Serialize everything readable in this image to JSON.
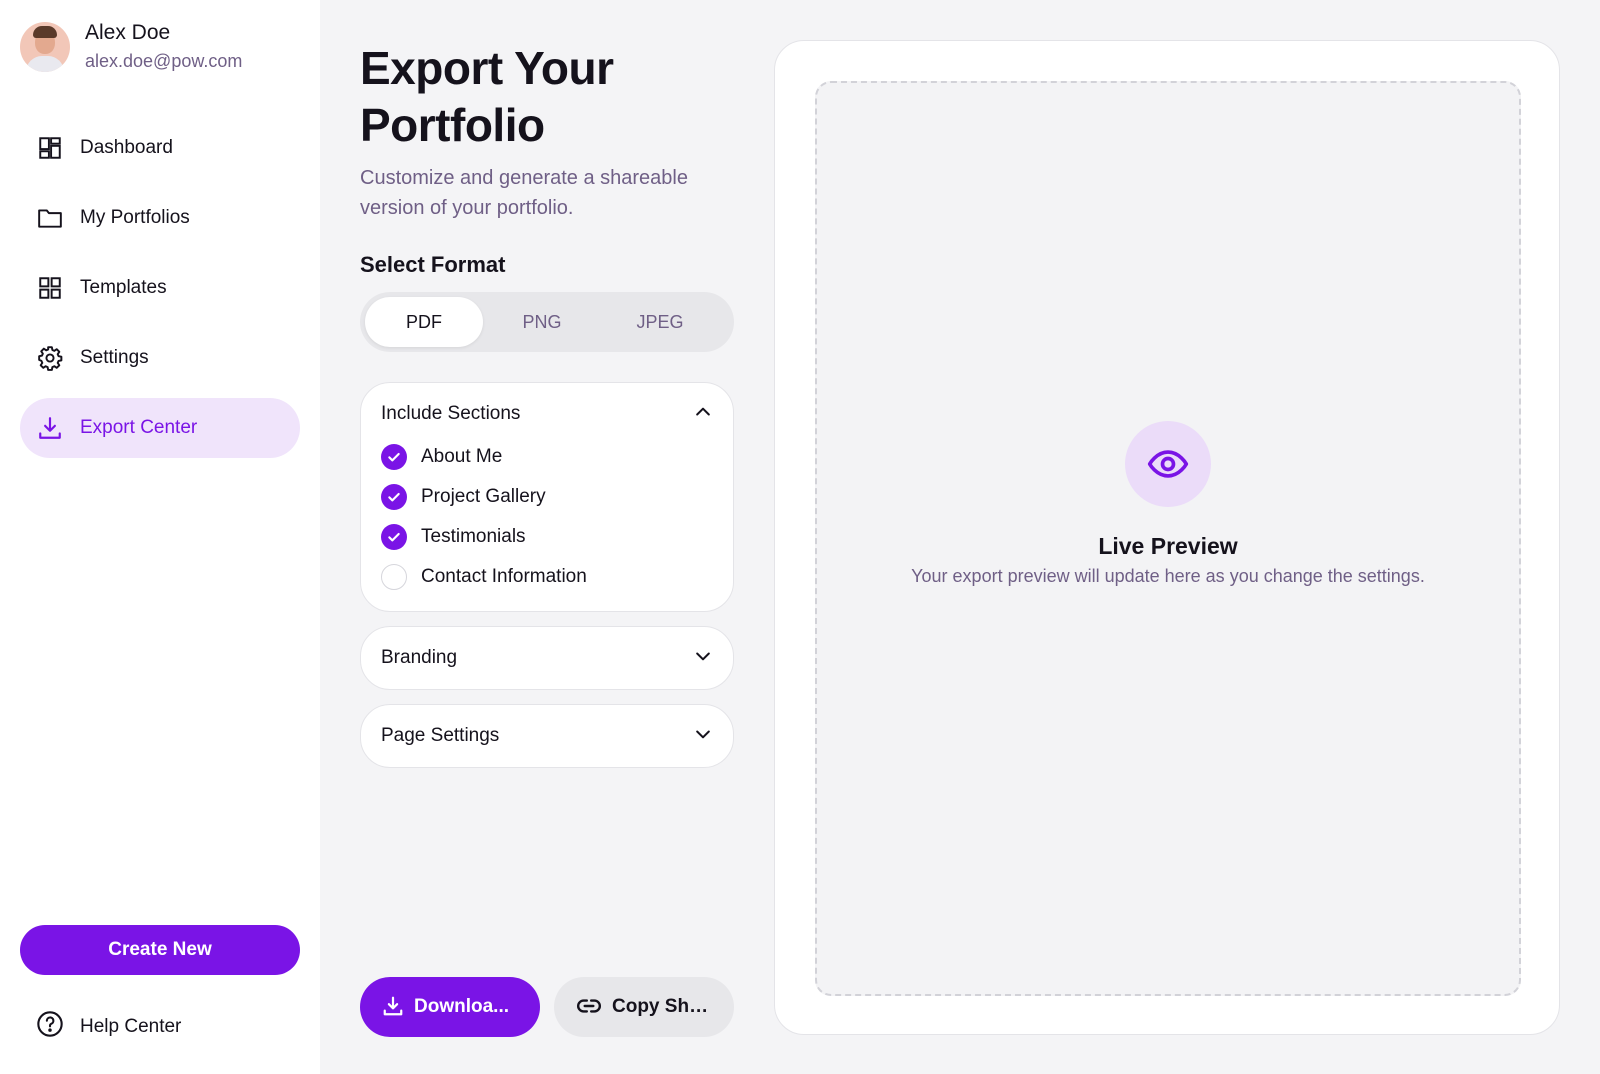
{
  "user": {
    "name": "Alex Doe",
    "email": "alex.doe@pow.com"
  },
  "nav": [
    {
      "label": "Dashboard",
      "icon": "dashboard-icon"
    },
    {
      "label": "My Portfolios",
      "icon": "folder-icon"
    },
    {
      "label": "Templates",
      "icon": "grid-icon"
    },
    {
      "label": "Settings",
      "icon": "gear-icon"
    },
    {
      "label": "Export Center",
      "icon": "download-icon",
      "active": true
    }
  ],
  "create_button": "Create New",
  "help_label": "Help Center",
  "page": {
    "title": "Export Your Portfolio",
    "subtitle": "Customize and generate a shareable version of your portfolio."
  },
  "format": {
    "label": "Select Format",
    "options": [
      "PDF",
      "PNG",
      "JPEG"
    ],
    "selected": "PDF"
  },
  "sections": {
    "title": "Include Sections",
    "items": [
      {
        "label": "About Me",
        "checked": true
      },
      {
        "label": "Project Gallery",
        "checked": true
      },
      {
        "label": "Testimonials",
        "checked": true
      },
      {
        "label": "Contact Information",
        "checked": false
      }
    ]
  },
  "branding": {
    "title": "Branding"
  },
  "page_settings": {
    "title": "Page Settings"
  },
  "actions": {
    "download": "Downloa...",
    "copy": "Copy Sha..."
  },
  "preview": {
    "title": "Live Preview",
    "text": "Your export preview will update here as you change the settings."
  },
  "colors": {
    "accent": "#7a14e6",
    "accent_soft": "#f0e4fb",
    "muted_text": "#6f5f86"
  }
}
